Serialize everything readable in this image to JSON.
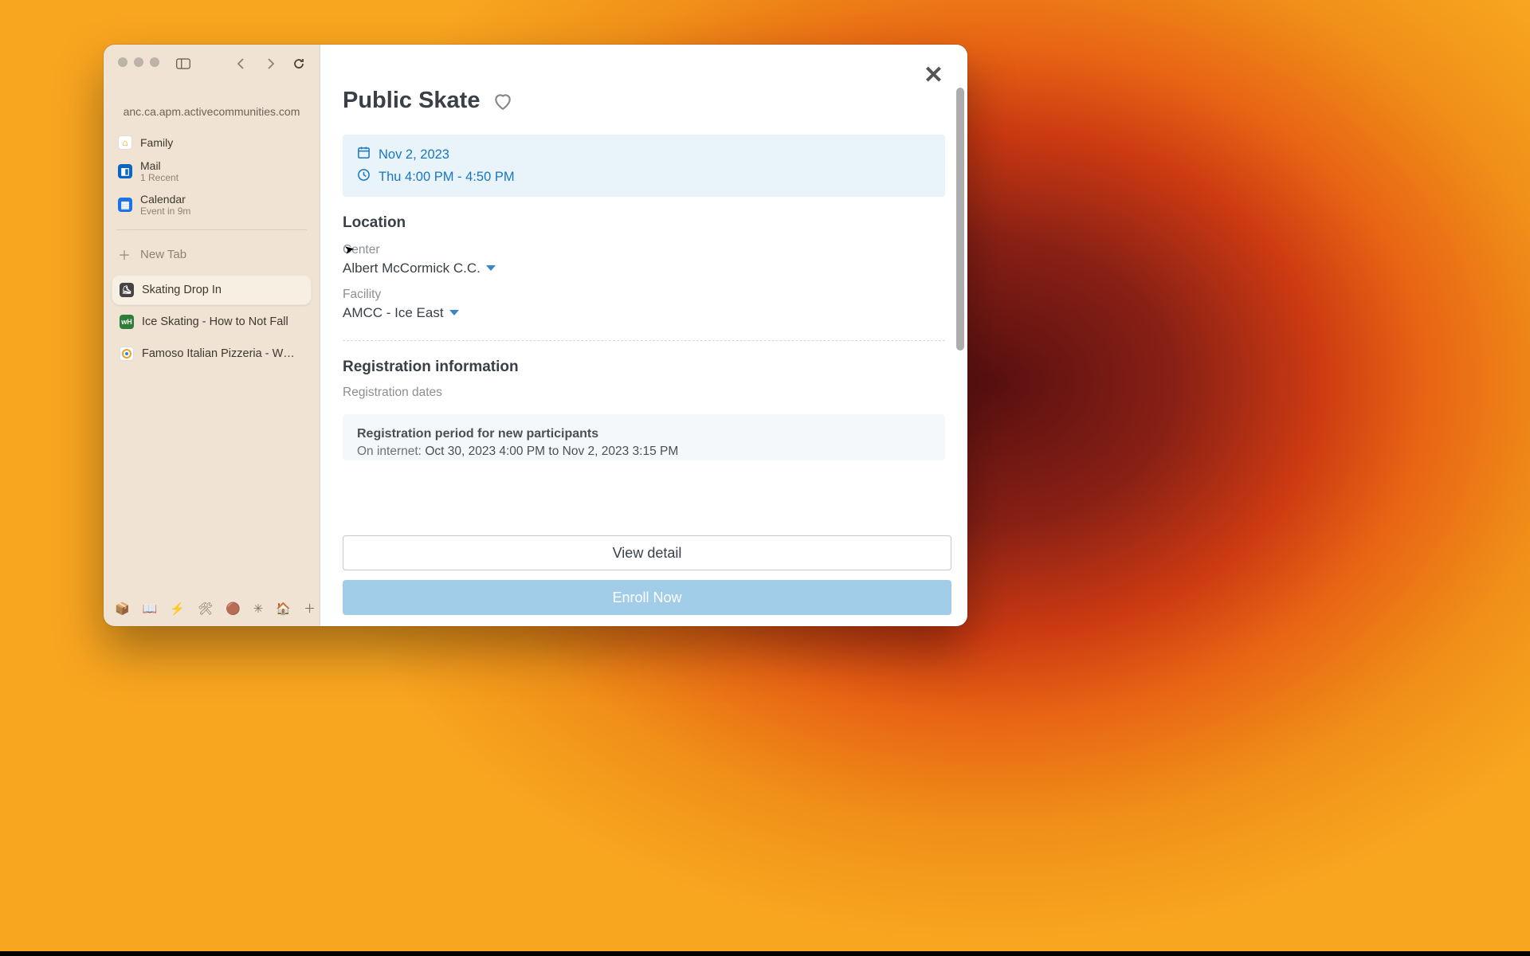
{
  "url": "anc.ca.apm.activecommunities.com",
  "sidebar": {
    "pinned": [
      {
        "title": "Family",
        "subtitle": ""
      },
      {
        "title": "Mail",
        "subtitle": "1 Recent"
      },
      {
        "title": "Calendar",
        "subtitle": "Event in 9m"
      }
    ],
    "new_tab_label": "New Tab",
    "tabs": [
      {
        "title": "Skating Drop In",
        "active": true
      },
      {
        "title": "Ice Skating - How to Not Fall",
        "active": false
      },
      {
        "title": "Famoso Italian Pizzeria - W…",
        "active": false
      }
    ]
  },
  "modal": {
    "title": "Public Skate",
    "date": "Nov 2, 2023",
    "time": "Thu 4:00 PM - 4:50 PM",
    "location_heading": "Location",
    "center_label": "Center",
    "center_value": "Albert McCormick C.C.",
    "facility_label": "Facility",
    "facility_value": "AMCC - Ice East",
    "registration_heading": "Registration information",
    "registration_dates_label": "Registration dates",
    "reg_period_title": "Registration period for new participants",
    "reg_on_internet_label": "On internet:",
    "reg_on_internet_value": "Oct 30, 2023 4:00 PM to Nov 2, 2023 3:15 PM",
    "view_detail_label": "View detail",
    "enroll_label": "Enroll Now"
  }
}
